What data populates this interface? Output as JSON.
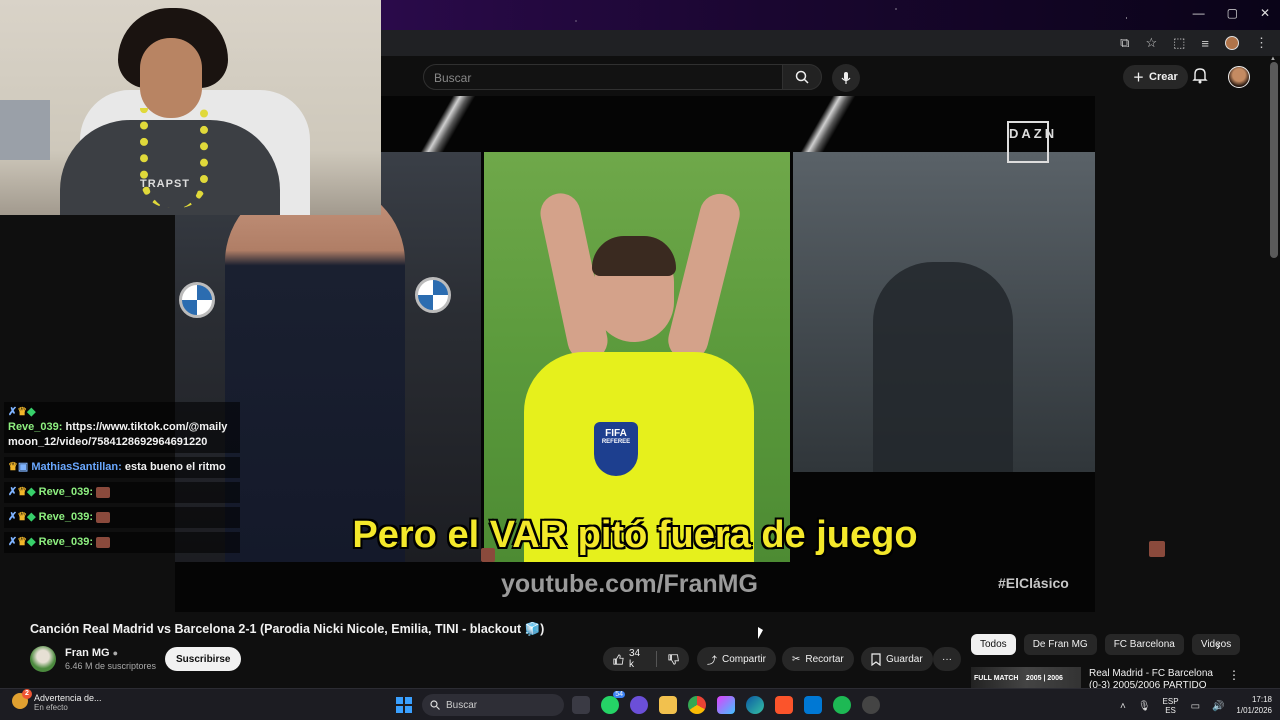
{
  "browser": {
    "window_controls": [
      "—",
      "▢",
      "✕"
    ]
  },
  "yt_header": {
    "search_placeholder": "Buscar",
    "create_label": "Crear"
  },
  "video": {
    "caption": "Pero el VAR pitó fuera de juego",
    "watermark_url": "youtube.com/FranMG",
    "hashtag": "#ElClásico",
    "broadcaster_logo": "DAZN",
    "fifa_badge": "FIFA",
    "referee_label": "REFEREE",
    "shirt_text": "TRAPST"
  },
  "chat": {
    "messages": [
      {
        "user": "Reve_039:",
        "text": "https://www.tiktok.com/@mailymoon_12/video/7584128692964691220",
        "user_color": "green",
        "inline_user": false
      },
      {
        "user": "MathiasSantillan:",
        "text": "esta bueno el ritmo",
        "user_color": "blue",
        "inline_user": true
      },
      {
        "user": "Reve_039:",
        "text": "",
        "user_color": "green",
        "inline_user": true
      },
      {
        "user": "Reve_039:",
        "text": "",
        "user_color": "green",
        "inline_user": true
      },
      {
        "user": "Reve_039:",
        "text": "",
        "user_color": "green",
        "inline_user": true
      }
    ]
  },
  "watch": {
    "title": "Canción Real Madrid vs Barcelona 2-1 (Parodia Nicki Nicole, Emilia, TINI - blackout 🧊)",
    "channel_name": "Fran MG",
    "subscribers": "6.46 M de suscriptores",
    "subscribe_label": "Suscribirse",
    "like_count": "34 k",
    "share_label": "Compartir",
    "clip_label": "Recortar",
    "save_label": "Guardar",
    "more_label": "···"
  },
  "sidebar": {
    "chips": [
      "Todos",
      "De Fran MG",
      "FC Barcelona",
      "Videos"
    ],
    "rec_thumb_text": "FULL MATCH",
    "rec_thumb_sub": "2005 | 2006",
    "rec_title": "Real Madrid - FC Barcelona (0-3) 2005/2006 PARTIDO"
  },
  "taskbar": {
    "notification_title": "Advertencia de...",
    "notification_sub": "En efecto",
    "notification_badge": "2",
    "search_label": "Buscar",
    "lang_top": "ESP",
    "lang_bottom": "ES",
    "time": "17:18",
    "date": "1/01/2026",
    "app_badge": "54"
  }
}
